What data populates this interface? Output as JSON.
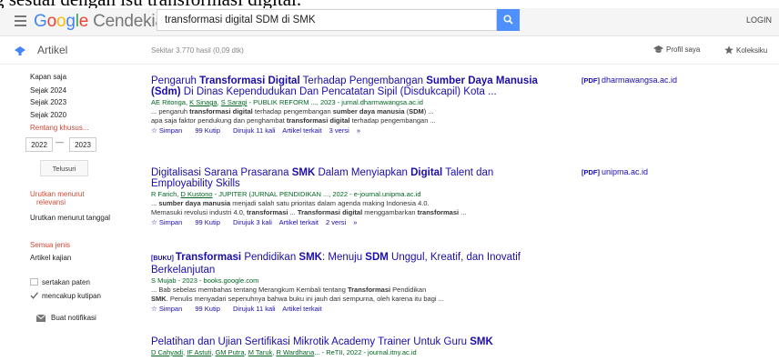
{
  "caption_fragment": "g sesuai dengan isu transformasi digital.",
  "header": {
    "logo_google": "Google",
    "logo_product": "Cendekia",
    "search_value": "transformasi digital SDM di SMK",
    "login_label": "LOGIN",
    "icons": [
      "menu-icon",
      "search-icon"
    ]
  },
  "subheader": {
    "section_title": "Artikel",
    "results_count": "Sekitar 3.770 hasil (0,09 dtk)",
    "profile_label": "Profil saya",
    "library_label": "Koleksiku"
  },
  "sidebar": {
    "time_filters": [
      "Kapan saja",
      "Sejak 2024",
      "Sejak 2023",
      "Sejak 2020",
      "Rentang khusus..."
    ],
    "year_from": "2022",
    "year_separator": "—",
    "year_to": "2023",
    "search_button": "Telusuri",
    "sort_relevance_line1": "Urutkan menurut",
    "sort_relevance_line2": "relevansi",
    "sort_date": "Urutkan menurut tanggal",
    "type_all": "Semua jenis",
    "type_review": "Artikel kajian",
    "include_patents": "sertakan paten",
    "include_citations": "mencakup kutipan",
    "create_alert": "Buat notifikasi"
  },
  "colors": {
    "link": "#1a0dab",
    "authors_green": "#006621",
    "accent_red": "#d14836",
    "search_blue": "#4d90fe"
  },
  "results": [
    {
      "title_parts": [
        "Pengaruh ",
        "Transformasi Digital",
        " Terhadap Pengembangan ",
        "Sumber Daya",
        " ",
        "Manusia (Sdm)",
        " Di Dinas Kependudukan Dan Pencatatan Sipil (Disdukcapil) Kota ..."
      ],
      "authors_parts": [
        "AE Ritonga, ",
        "K Sinaga",
        ", ",
        "S Saragi",
        " - PUBLIK REFORM ..., 2023 - jurnal.dharmawangsa.ac.id"
      ],
      "snippet1": [
        "... pengaruh ",
        "transformasi digital",
        " terhadap pengembangan ",
        "sumber daya manusia",
        " (",
        "SDM",
        ") ..."
      ],
      "snippet2": [
        "apa saja faktor pendukung dan penghambat ",
        "transformasi digital",
        " terhadap pengembangan ..."
      ],
      "links": [
        "Simpan",
        "Kutip",
        "Dirujuk 11 kali",
        "Artikel terkait",
        "3 versi"
      ],
      "side_tag": "[PDF]",
      "side_domain": "dharmawangsa.ac.id"
    },
    {
      "title_parts": [
        "Digitalisasi Sarana Prasarana ",
        "SMK",
        " Dalam Menyiapkan ",
        "Digital",
        " Talent dan Employability Skills"
      ],
      "authors_parts": [
        "R Farich, ",
        "D Kustono",
        " - JUPITER (JURNAL PENDIDIKAN ..., 2022 - e-journal.unipma.ac.id"
      ],
      "snippet1": [
        "... ",
        "sumber daya manusia",
        " menjadi salah satu prioritas dalam agenda making Indonesia 4.0."
      ],
      "snippet2": [
        "Memasuki revolusi industri 4.0, ",
        "transformasi",
        " ... ",
        "Transformasi digital",
        " menggambarkan ",
        "transformasi",
        " ..."
      ],
      "links": [
        "Simpan",
        "Kutip",
        "Dirujuk 3 kali",
        "Artikel terkait",
        "2 versi"
      ],
      "side_tag": "[PDF]",
      "side_domain": "unipma.ac.id"
    },
    {
      "tag": "[BUKU]",
      "title_parts": [
        "Transformasi",
        " Pendidikan ",
        "SMK",
        ": Menuju ",
        "SDM",
        " Unggul, Kreatif, dan Inovatif Berkelanjutan"
      ],
      "authors_parts": [
        "S Mujab - 2023 - books.google.com"
      ],
      "snippet1": [
        "... Bab sebelas membahas tentang Merangkum Kembali tentang ",
        "Transformasi",
        " Pendidikan"
      ],
      "snippet2": [
        "SMK",
        ". Penulis menyadari sepenuhnya bahwa buku ini jauh dari sempurna, oleh karena itu bagi ..."
      ],
      "links": [
        "Simpan",
        "Kutip",
        "Dirujuk 11 kali",
        "Artikel terkait"
      ]
    },
    {
      "title_parts": [
        "Pelatihan dan Ujian Sertifikasi Mikrotik Academy Trainer Untuk Guru ",
        "SMK"
      ],
      "authors_parts": [
        "D Cahyadi",
        ", ",
        "IF Astuti",
        ", ",
        "GM Putra",
        ", ",
        "M Taruk",
        ", ",
        "R Wardhana",
        "... - ReTII, 2022 - journal.itny.ac.id"
      ]
    }
  ]
}
